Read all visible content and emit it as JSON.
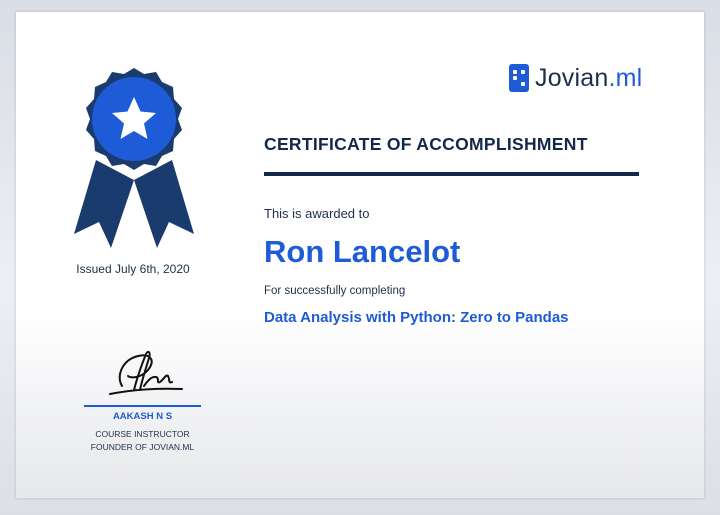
{
  "logo": {
    "name": "Jovian",
    "suffix": ".ml",
    "icon": "jovian-logo-icon"
  },
  "badge": {
    "icon": "award-ribbon-icon",
    "star_icon": "star-icon"
  },
  "issued": "Issued July 6th, 2020",
  "certificate": {
    "heading": "CERTIFICATE OF ACCOMPLISHMENT",
    "awarded_to_label": "This is awarded to",
    "recipient": "Ron Lancelot",
    "completing_label": "For successfully completing",
    "course": "Data Analysis with Python: Zero to Pandas"
  },
  "signatory": {
    "name": "AAKASH N S",
    "title_line1": "COURSE INSTRUCTOR",
    "title_line2": "FOUNDER OF JOVIAN.ML"
  },
  "colors": {
    "primary_blue": "#1e5bd6",
    "navy": "#14284b",
    "dark_navy": "#1a3b6e"
  }
}
